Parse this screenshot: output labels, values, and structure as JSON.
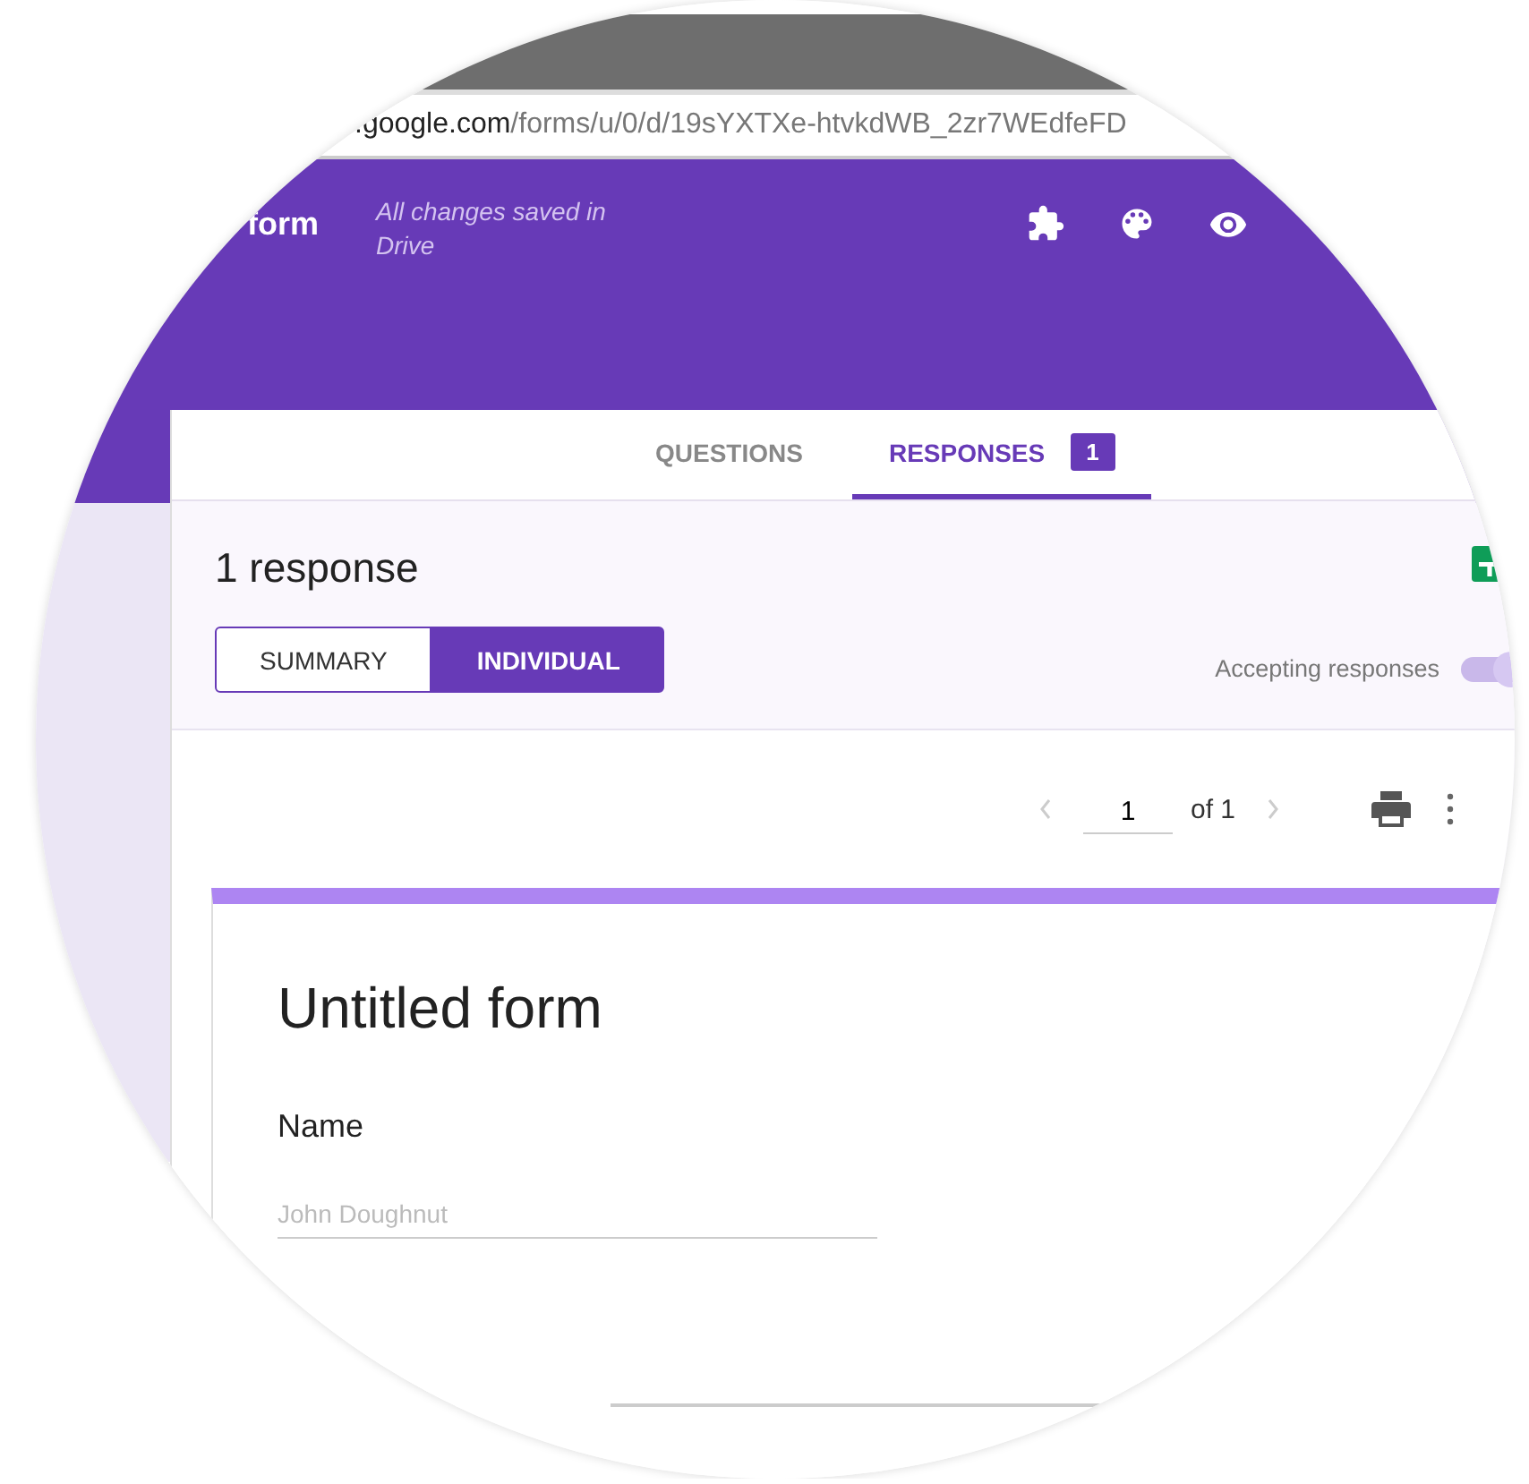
{
  "browser": {
    "url_host": ".google.com",
    "url_path": "/forms/u/0/d/19sYXTXe-htvkdWB_2zr7WEdfeFD"
  },
  "header": {
    "title": "form",
    "save_status": "All changes saved in Drive"
  },
  "tabs": [
    {
      "label": "QUESTIONS",
      "selected": false
    },
    {
      "label": "RESPONSES",
      "selected": true,
      "badge": "1"
    }
  ],
  "responses": {
    "count_text": "1 response",
    "views": [
      {
        "label": "SUMMARY",
        "selected": false
      },
      {
        "label": "INDIVIDUAL",
        "selected": true
      }
    ],
    "accepting": {
      "label": "Accepting responses",
      "on": true
    }
  },
  "pager": {
    "page": "1",
    "total": "of 1"
  },
  "form": {
    "title": "Untitled form",
    "questions": [
      {
        "label": "Name",
        "answer": "John Doughnut"
      }
    ]
  }
}
